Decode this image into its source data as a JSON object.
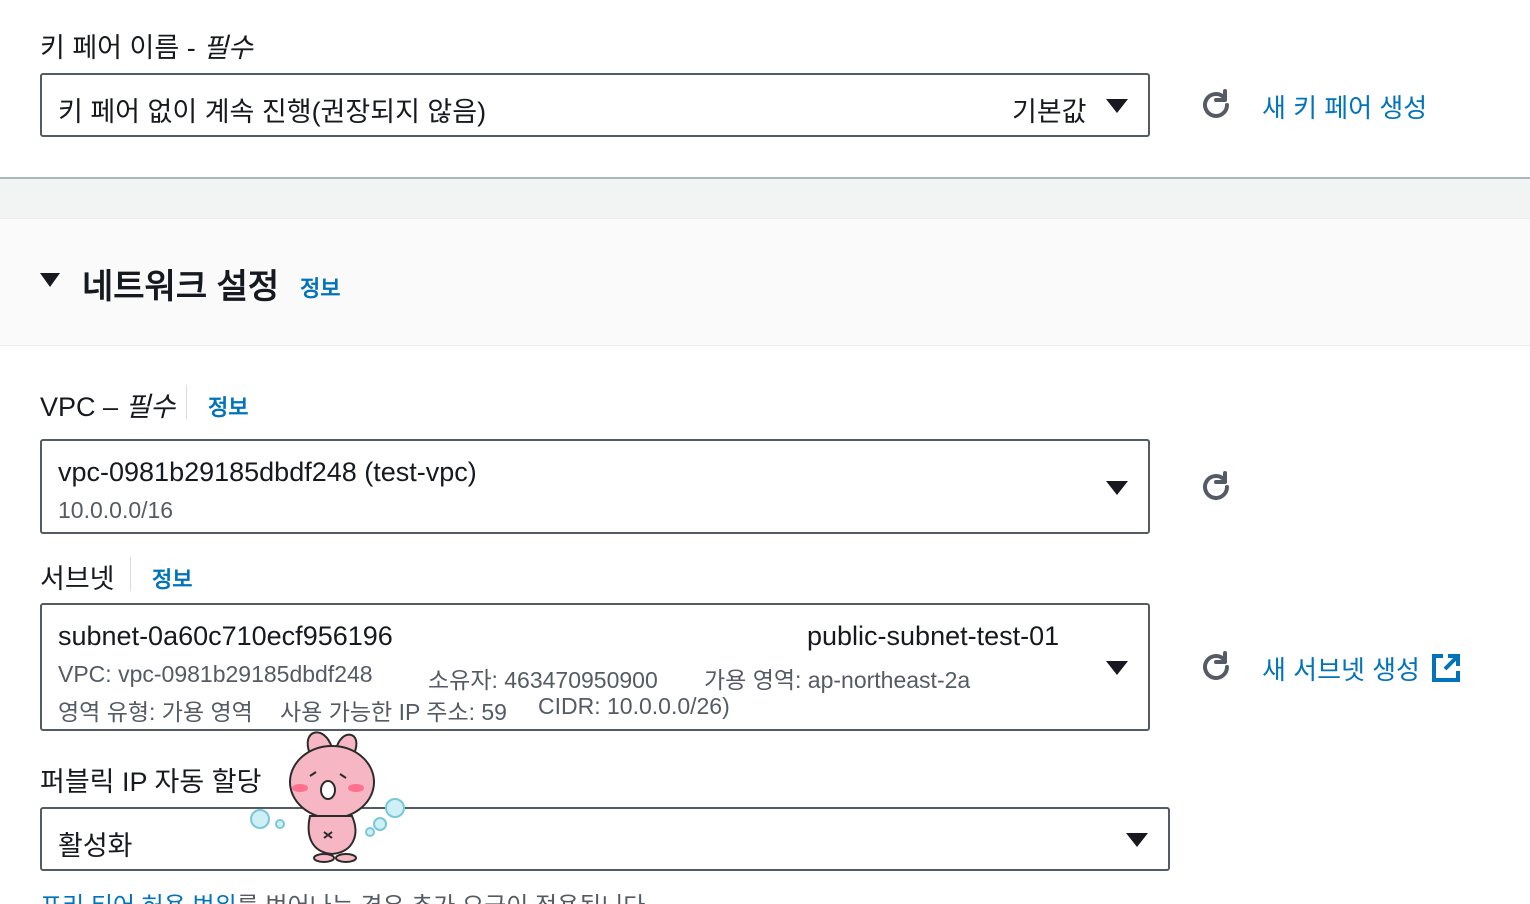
{
  "key_pair": {
    "label": "키 페어 이름 - ",
    "label_required": "필수",
    "value": "키 페어 없이 계속 진행(권장되지 않음)",
    "default_tag": "기본값",
    "create_link": "새 키 페어 생성"
  },
  "network": {
    "title": "네트워크 설정",
    "info": "정보"
  },
  "vpc": {
    "label": "VPC – ",
    "label_required": "필수",
    "info": "정보",
    "value": "vpc-0981b29185dbdf248 (test-vpc)",
    "cidr": "10.0.0.0/16"
  },
  "subnet": {
    "label": "서브넷",
    "info": "정보",
    "id": "subnet-0a60c710ecf956196",
    "name": "public-subnet-test-01",
    "vpc": "VPC: vpc-0981b29185dbdf248",
    "owner": "소유자: 463470950900",
    "az": "가용 영역: ap-northeast-2a",
    "zone_type": "영역 유형: 가용 영역",
    "available_ips": "사용 가능한 IP 주소: 59",
    "cidr": "CIDR: 10.0.0.0/26)",
    "create_link": "새 서브넷 생성"
  },
  "public_ip": {
    "label": "퍼블릭 IP 자동 할당",
    "value": "활성화"
  },
  "footer": {
    "link": "프리 티어 허용 범위",
    "text": "를 벗어나는 경우 추가 요금이 적용됩니다"
  },
  "colors": {
    "link": "#0073bb",
    "border": "#545b64",
    "band": "#f2f3f3"
  },
  "icons": [
    "refresh-icon",
    "external-link-icon",
    "caret-down-icon",
    "expand-caret-icon",
    "sticker-bunny"
  ]
}
